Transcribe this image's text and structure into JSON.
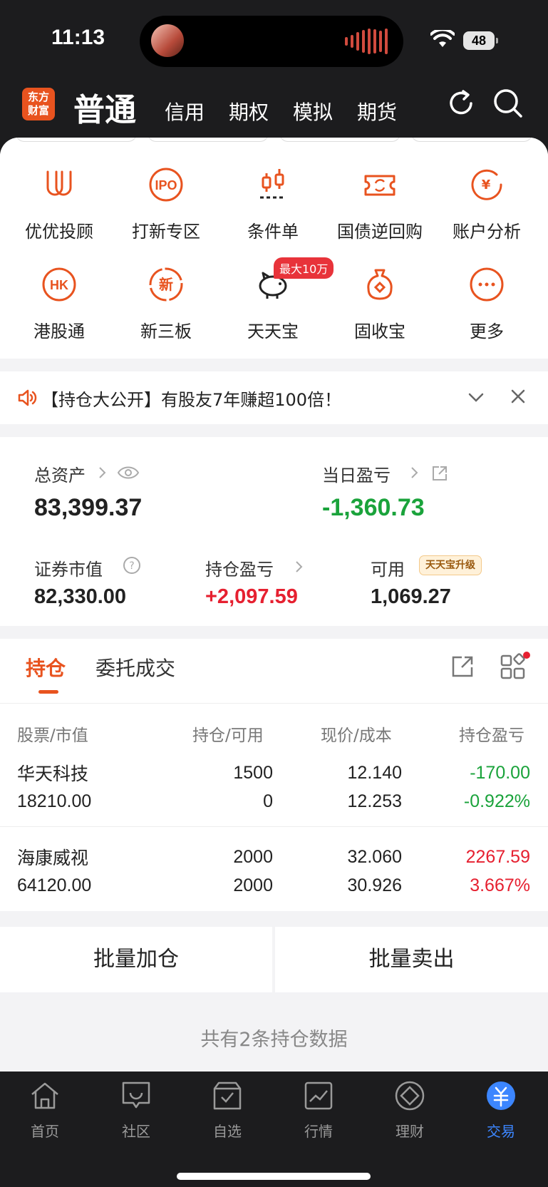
{
  "status": {
    "time": "11:13",
    "battery": "48"
  },
  "topnav": {
    "logo_text": "东方\n财富",
    "active_tab": "普通",
    "tabs": [
      "信用",
      "期权",
      "模拟",
      "期货"
    ]
  },
  "quick_actions": [
    {
      "label": "优优投顾",
      "icon": "uu-advisor-icon"
    },
    {
      "label": "打新专区",
      "icon": "ipo-icon"
    },
    {
      "label": "条件单",
      "icon": "candlestick-icon"
    },
    {
      "label": "国债逆回购",
      "icon": "bond-repo-icon"
    },
    {
      "label": "账户分析",
      "icon": "account-analysis-icon"
    },
    {
      "label": "港股通",
      "icon": "hk-connect-icon"
    },
    {
      "label": "新三板",
      "icon": "neeq-icon"
    },
    {
      "label": "天天宝",
      "icon": "piggy-bank-icon"
    },
    {
      "label": "固收宝",
      "icon": "money-bag-icon"
    },
    {
      "label": "更多",
      "icon": "more-icon"
    }
  ],
  "tiantianbao_badge": "最大10万",
  "notice": {
    "text": "【持仓大公开】有股友7年赚超100倍！"
  },
  "assets": {
    "total_label": "总资产",
    "total_value": "83,399.37",
    "daily_pnl_label": "当日盈亏",
    "daily_pnl_value": "-1,360.73",
    "market_value_label": "证券市值",
    "market_value": "82,330.00",
    "position_pnl_label": "持仓盈亏",
    "position_pnl_value": "+2,097.59",
    "available_label": "可用",
    "available_value": "1,069.27",
    "upgrade_badge": "天天宝升级"
  },
  "holdings": {
    "tabs": [
      "持仓",
      "委托成交"
    ],
    "columns": [
      "股票/市值",
      "持仓/可用",
      "现价/成本",
      "持仓盈亏"
    ],
    "rows": [
      {
        "name": "华天科技",
        "market_value": "18210.00",
        "position": "1500",
        "available": "0",
        "price": "12.140",
        "cost": "12.253",
        "pnl": "-170.00",
        "pnl_pct": "-0.922%"
      },
      {
        "name": "海康威视",
        "market_value": "64120.00",
        "position": "2000",
        "available": "2000",
        "price": "32.060",
        "cost": "30.926",
        "pnl": "2267.59",
        "pnl_pct": "3.667%"
      }
    ]
  },
  "batch": {
    "add": "批量加仓",
    "sell": "批量卖出"
  },
  "summary": "共有2条持仓数据",
  "tabbar": [
    {
      "label": "首页",
      "icon": "home-icon"
    },
    {
      "label": "社区",
      "icon": "community-icon"
    },
    {
      "label": "自选",
      "icon": "watchlist-icon"
    },
    {
      "label": "行情",
      "icon": "market-icon"
    },
    {
      "label": "理财",
      "icon": "wealth-icon"
    },
    {
      "label": "交易",
      "icon": "trade-icon"
    }
  ],
  "colors": {
    "accent": "#e8531f",
    "up": "#e62030",
    "down": "#1aa33b",
    "active_tab": "#3c86ff"
  }
}
